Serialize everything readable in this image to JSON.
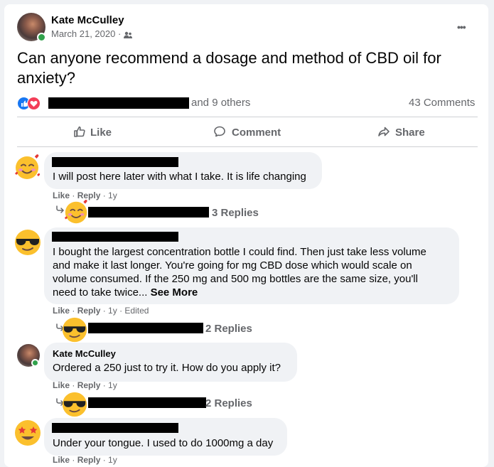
{
  "post": {
    "author": "Kate McCulley",
    "date": "March 21, 2020",
    "title": "Can anyone recommend a dosage and method of CBD oil for anxiety?",
    "reactions_suffix": "and 9 others",
    "comment_count": "43 Comments",
    "more_icon": "•••"
  },
  "actions": {
    "like": "Like",
    "comment": "Comment",
    "share": "Share"
  },
  "comments": [
    {
      "text": "I will post here later with what I take. It is life changing",
      "like": "Like",
      "reply": "Reply",
      "time": "1y",
      "replies": "3 Replies"
    },
    {
      "text_lines": [
        "I bought the largest concentration bottle I could find. Then just take less volume",
        "and make it last longer. You're going for mg CBD dose which would scale on",
        "volume consumed. If the 250 mg and 500 mg bottles are the same size, you'll",
        "need to take twice... "
      ],
      "see_more": "See More",
      "like": "Like",
      "reply": "Reply",
      "time": "1y",
      "edited": "Edited",
      "replies": "2 Replies"
    },
    {
      "author": "Kate McCulley",
      "text": "Ordered a 250 just to try it. How do you apply it?",
      "like": "Like",
      "reply": "Reply",
      "time": "1y",
      "replies": "2 Replies"
    },
    {
      "text": "Under your tongue. I used to do 1000mg a day",
      "like": "Like",
      "reply": "Reply",
      "time": "1y"
    }
  ],
  "colors": {
    "like_blue": "#1877f2",
    "love_red": "#f33e58",
    "online_green": "#31a24c"
  }
}
